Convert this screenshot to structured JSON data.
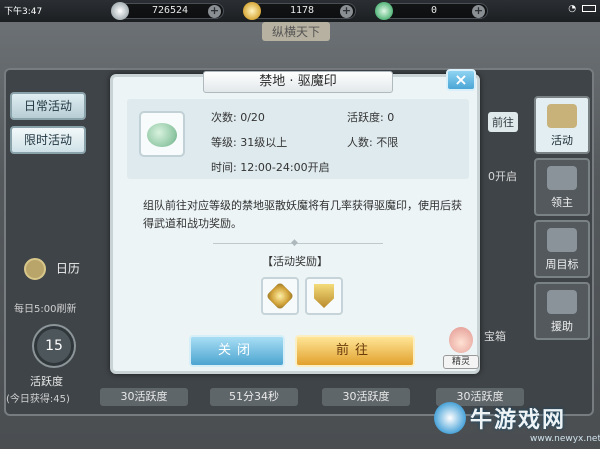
{
  "status_bar": {
    "time": "下午3:47"
  },
  "resources": [
    {
      "name": "silver",
      "value": "726524",
      "icon": "silver-coin-icon",
      "color": "#c7cfd2"
    },
    {
      "name": "gold",
      "value": "1178",
      "icon": "gold-ingot-icon",
      "color": "#e7c24a"
    },
    {
      "name": "jade",
      "value": "0",
      "icon": "jade-gem-icon",
      "color": "#6cc58a"
    }
  ],
  "background": {
    "window_title": "纵横天下",
    "left_tabs": [
      "日常活动",
      "限时活动"
    ],
    "calendar_label": "日历",
    "refresh_text": "每日5:00刷新",
    "activity_points": "15",
    "activity_label": "活跃度",
    "today_gain": "(今日获得:45)",
    "side_buttons": [
      "活动",
      "领主",
      "周目标",
      "援助"
    ],
    "peek_go": "前往",
    "peek_open": "0开启",
    "peek_box": "宝箱",
    "bottom_cells": [
      "30活跃度",
      "51分34秒",
      "30活跃度",
      "30活跃度"
    ]
  },
  "dialog": {
    "title": "禁地 · 驱魔印",
    "times": "次数: 0/20",
    "activity": "活跃度: 0",
    "level": "等级: 31级以上",
    "people": "人数: 不限",
    "time": "时间: 12:00-24:00开启",
    "description": "组队前往对应等级的禁地驱散妖魔将有几率获得驱魔印，使用后获得武道和战功奖励。",
    "reward_title": "【活动奖励】",
    "close_label": "关闭",
    "go_label": "前往",
    "spirit_label": "精灵"
  },
  "watermark": {
    "site": "牛游戏网",
    "url": "www.newyx.net"
  }
}
